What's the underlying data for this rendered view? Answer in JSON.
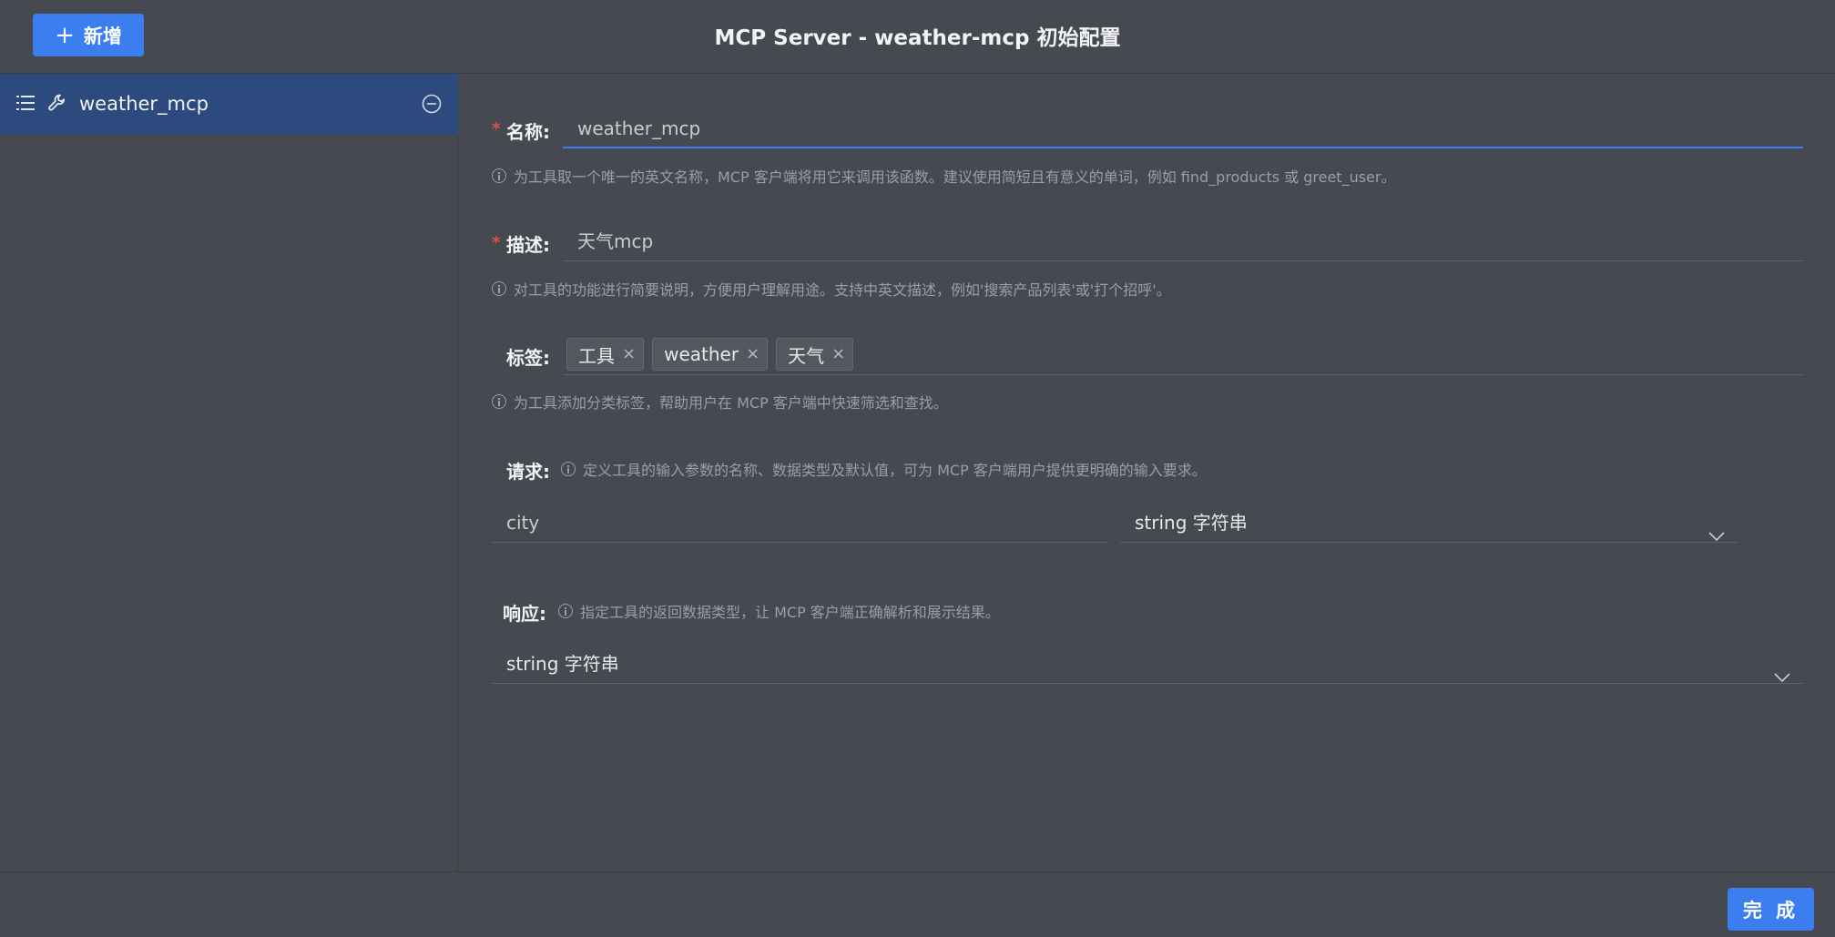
{
  "header": {
    "add_button_label": "新增",
    "title": "MCP Server - weather-mcp 初始配置"
  },
  "sidebar": {
    "items": [
      {
        "label": "weather_mcp"
      }
    ]
  },
  "form": {
    "name": {
      "label": "名称:",
      "value": "weather_mcp",
      "hint": "为工具取一个唯一的英文名称，MCP 客户端将用它来调用该函数。建议使用简短且有意义的单词，例如 find_products 或 greet_user。"
    },
    "description": {
      "label": "描述:",
      "value": "天气mcp",
      "hint": "对工具的功能进行简要说明，方便用户理解用途。支持中英文描述，例如'搜索产品列表'或'打个招呼'。"
    },
    "tags": {
      "label": "标签:",
      "items": [
        "工具",
        "weather",
        "天气"
      ],
      "hint": "为工具添加分类标签，帮助用户在 MCP 客户端中快速筛选和查找。"
    },
    "request": {
      "label": "请求:",
      "hint": "定义工具的输入参数的名称、数据类型及默认值，可为 MCP 客户端用户提供更明确的输入要求。",
      "param_name": "city",
      "param_type": "string 字符串"
    },
    "response": {
      "label": "响应:",
      "hint": "指定工具的返回数据类型，让 MCP 客户端正确解析和展示结果。",
      "type": "string 字符串"
    }
  },
  "footer": {
    "done_button_label": "完 成"
  },
  "colors": {
    "background": "#464a50",
    "accent": "#3b7ef0",
    "sidebar_selected": "#2d4a7e",
    "required": "#e34d4d"
  }
}
